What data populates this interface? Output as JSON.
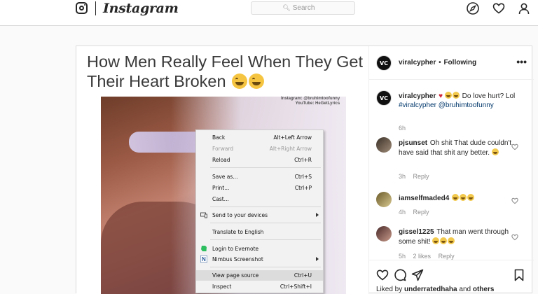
{
  "nav": {
    "brand": "Instagram",
    "search_placeholder": "Search"
  },
  "post": {
    "media": {
      "caption_title": "How Men Really Feel When They Get Their Heart Broken",
      "credit_1": "Instagram: @bruhimtoofunny",
      "credit_2": "YouTube: HeGetLyrics"
    },
    "header": {
      "username": "viralcypher",
      "dot": "•",
      "follow_status": "Following",
      "avatar_text": "VC"
    },
    "caption": {
      "username": "viralcypher",
      "text": "Do love hurt? Lol",
      "tags": "#viralcypher @bruhimtoofunny",
      "time": "6h"
    },
    "comments": [
      {
        "username": "pjsunset",
        "text": "Oh shit That dude couldn't have said that shit any better.",
        "time": "3h",
        "reply": "Reply"
      },
      {
        "username": "iamselfmaded4",
        "text": "",
        "time": "4h",
        "reply": "Reply"
      },
      {
        "username": "gissel1225",
        "text": "That man went through some shit!",
        "time": "5h",
        "likes": "2 likes",
        "reply": "Reply"
      }
    ],
    "likes": {
      "prefix": "Liked by",
      "user": "underratedhaha",
      "joiner": "and",
      "others": "others"
    }
  },
  "context_menu": {
    "items": [
      {
        "label": "Back",
        "shortcut": "Alt+Left Arrow"
      },
      {
        "label": "Forward",
        "shortcut": "Alt+Right Arrow"
      },
      {
        "label": "Reload",
        "shortcut": "Ctrl+R"
      },
      {
        "label": "Save as...",
        "shortcut": "Ctrl+S"
      },
      {
        "label": "Print...",
        "shortcut": "Ctrl+P"
      },
      {
        "label": "Cast...",
        "shortcut": ""
      },
      {
        "label": "Send to your devices",
        "shortcut": ""
      },
      {
        "label": "Translate to English",
        "shortcut": ""
      },
      {
        "label": "Login to Evernote",
        "shortcut": ""
      },
      {
        "label": "Nimbus Screenshot",
        "shortcut": ""
      },
      {
        "label": "View page source",
        "shortcut": "Ctrl+U"
      },
      {
        "label": "Inspect",
        "shortcut": "Ctrl+Shift+I"
      }
    ]
  },
  "colors": {
    "link": "#00376b",
    "heart_red": "#d1273a",
    "border": "#dbdbdb",
    "menu_bg": "#f2f2f2",
    "menu_highlight": "#dcdcdc"
  }
}
